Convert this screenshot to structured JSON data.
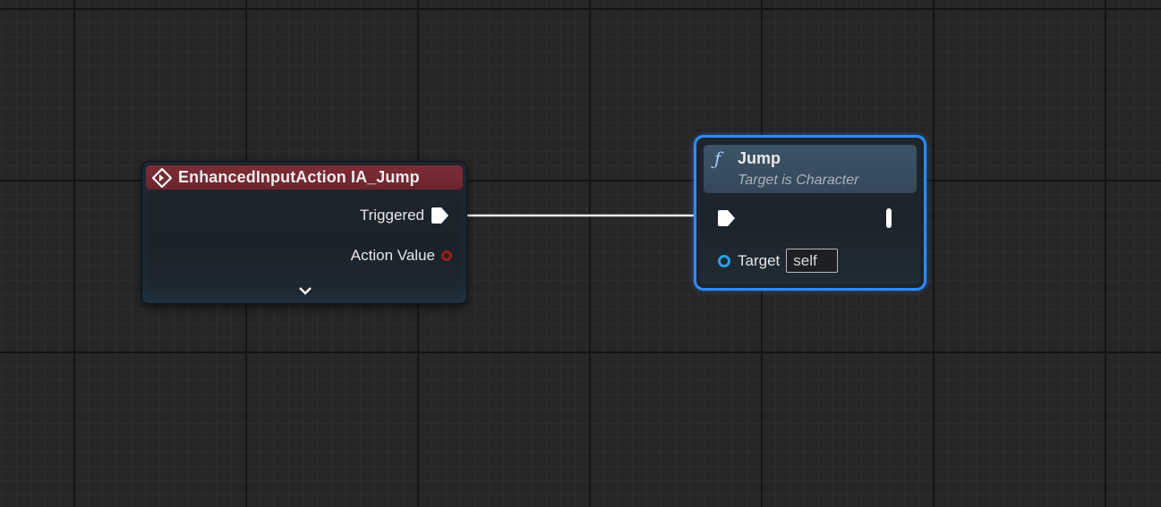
{
  "event_node": {
    "title": "EnhancedInputAction IA_Jump",
    "header_color": "#7e2c35",
    "icon": "event-diamond-icon",
    "outputs": [
      {
        "label": "Triggered",
        "pin_type": "exec"
      },
      {
        "label": "Action Value",
        "pin_type": "data",
        "color": "#a11a1a"
      }
    ],
    "expand_icon": "chevron-down-icon"
  },
  "function_node": {
    "icon": "function-icon",
    "title": "Jump",
    "subtitle": "Target is Character",
    "header_color": "#3d5367",
    "selection_color": "#2f8bff",
    "target_label": "Target",
    "target_value": "self",
    "target_pin_color": "#29a3e0"
  },
  "wire": {
    "from": "Triggered",
    "to": "Jump",
    "color": "#ffffff"
  }
}
